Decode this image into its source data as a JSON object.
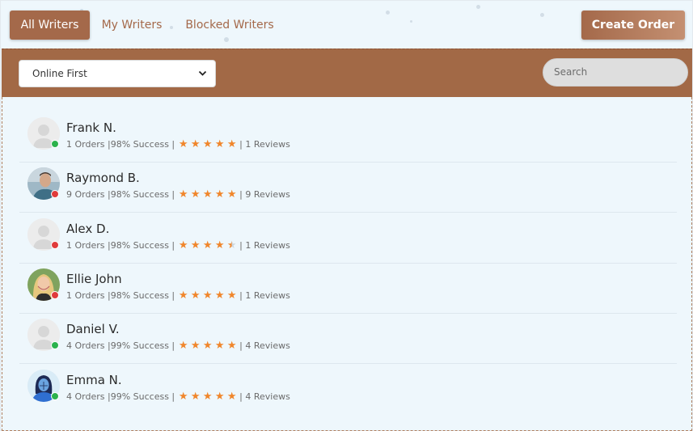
{
  "tabs": {
    "all": "All Writers",
    "my": "My Writers",
    "blocked": "Blocked Writers"
  },
  "create_order": "Create Order",
  "sort_select": {
    "value": "Online First"
  },
  "search": {
    "placeholder": "Search"
  },
  "colors": {
    "brand": "#a4694a",
    "star": "#f0862b",
    "online": "#2bb24c",
    "offline": "#e03b3b"
  },
  "writers": [
    {
      "name": "Frank N.",
      "orders": "1 Orders",
      "success": "98% Success",
      "rating": 5,
      "reviews": "1 Reviews",
      "status": "online",
      "avatar": "placeholder"
    },
    {
      "name": "Raymond B.",
      "orders": "9 Orders",
      "success": "98% Success",
      "rating": 5,
      "reviews": "9 Reviews",
      "status": "offline",
      "avatar": "photo-man"
    },
    {
      "name": "Alex D.",
      "orders": "1 Orders",
      "success": "98% Success",
      "rating": 4.5,
      "reviews": "1 Reviews",
      "status": "offline",
      "avatar": "placeholder"
    },
    {
      "name": "Ellie John",
      "orders": "1 Orders",
      "success": "98% Success",
      "rating": 5,
      "reviews": "1 Reviews",
      "status": "offline",
      "avatar": "photo-woman"
    },
    {
      "name": "Daniel V.",
      "orders": "4 Orders",
      "success": "99% Success",
      "rating": 5,
      "reviews": "4 Reviews",
      "status": "online",
      "avatar": "placeholder"
    },
    {
      "name": "Emma N.",
      "orders": "4 Orders",
      "success": "99% Success",
      "rating": 5,
      "reviews": "4 Reviews",
      "status": "online",
      "avatar": "illustration"
    }
  ]
}
